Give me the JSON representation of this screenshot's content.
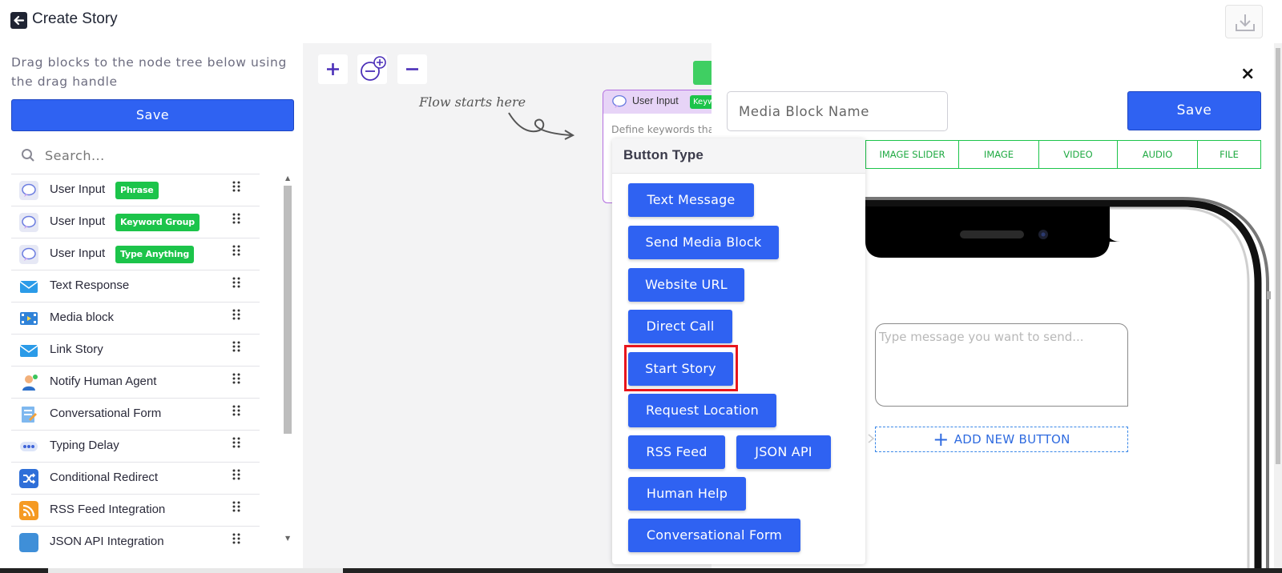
{
  "header": {
    "title": "Create Story",
    "back_icon": "back-arrow-icon",
    "download_icon": "download-icon"
  },
  "sidebar": {
    "hint": "Drag blocks to the node tree below using the drag handle",
    "save_label": "Save",
    "search_placeholder": "Search...",
    "items": [
      {
        "label": "User Input",
        "badge": "Phrase",
        "icon": "chat-bubble-icon"
      },
      {
        "label": "User Input",
        "badge": "Keyword Group",
        "icon": "chat-bubble-icon"
      },
      {
        "label": "User Input",
        "badge": "Type Anything",
        "icon": "chat-bubble-icon"
      },
      {
        "label": "Text Response",
        "badge": "",
        "icon": "envelope-icon"
      },
      {
        "label": "Media block",
        "badge": "",
        "icon": "film-icon"
      },
      {
        "label": "Link Story",
        "badge": "",
        "icon": "envelope-link-icon"
      },
      {
        "label": "Notify Human Agent",
        "badge": "",
        "icon": "agent-icon"
      },
      {
        "label": "Conversational Form",
        "badge": "",
        "icon": "form-icon"
      },
      {
        "label": "Typing Delay",
        "badge": "",
        "icon": "typing-dots-icon"
      },
      {
        "label": "Conditional Redirect",
        "badge": "",
        "icon": "shuffle-icon"
      },
      {
        "label": "RSS Feed Integration",
        "badge": "",
        "icon": "rss-icon"
      },
      {
        "label": "JSON API Integration",
        "badge": "",
        "icon": "code-icon"
      }
    ]
  },
  "canvas": {
    "zoom_in": "+",
    "zoom_out": "−",
    "flow_label": "Flow starts here",
    "node": {
      "title": "User Input",
      "badge": "Keyword Group",
      "description": "Define keywords that"
    }
  },
  "button_type_popup": {
    "title": "Button Type",
    "options": [
      "Text Message",
      "Send Media Block",
      "Website URL",
      "Direct Call",
      "Start Story",
      "Request Location",
      "RSS Feed",
      "JSON API",
      "Human Help",
      "Conversational Form"
    ],
    "highlighted": "Start Story"
  },
  "panel": {
    "close_icon": "×",
    "name_placeholder": "Media Block Name",
    "save_label": "Save",
    "tabs": [
      "IMAGE SLIDER",
      "IMAGE",
      "VIDEO",
      "AUDIO",
      "FILE"
    ],
    "message_placeholder": "Type message you want to send...",
    "add_button_label": "ADD NEW BUTTON"
  },
  "colors": {
    "primary": "#2f62f2",
    "badge_green": "#1cc44a",
    "highlight_red": "#e8151c",
    "node_purple": "#b36ee0"
  }
}
